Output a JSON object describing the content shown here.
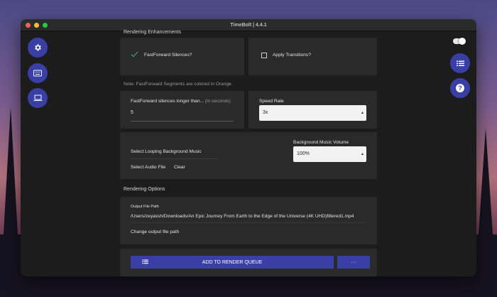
{
  "window": {
    "title": "TimeBolt | 4.4.1"
  },
  "sidebar_left": {
    "buttons": [
      {
        "icon": "gear-icon"
      },
      {
        "icon": "keyboard-icon"
      },
      {
        "icon": "laptop-icon"
      }
    ]
  },
  "sidebar_right": {
    "buttons": [
      {
        "icon": "list-icon"
      },
      {
        "icon": "help-icon"
      }
    ]
  },
  "rendering_enhancements": {
    "title": "Rendering Enhancements",
    "fastforward_silences": {
      "label": "FastForward Silences?",
      "checked": true
    },
    "apply_transitions": {
      "label": "Apply Transitions?",
      "checked": false
    },
    "note": "Note: FastForward Segments are colored in Orange.",
    "silence_threshold": {
      "label": "FastForward silences longer than...",
      "hint": "(in seconds)",
      "value": "5"
    },
    "speed_rate": {
      "label": "Speed Rate",
      "value": "3x"
    },
    "music": {
      "select_label": "Select Looping Background Music",
      "select_audio": "Select Audio File",
      "clear": "Clear",
      "volume_label": "Background Music Volume",
      "volume_value": "100%"
    }
  },
  "rendering_options": {
    "title": "Rendering Options",
    "output_label": "Output File Path",
    "output_path": "/Users/zeyassh/Downloads/An Epic Journey From Earth to the Edge of the Universe (4K UHD)filtered1.mp4",
    "change_path": "Change output file path"
  },
  "actions": {
    "add_to_queue": "ADD TO RENDER QUEUE",
    "more": "···"
  },
  "colors": {
    "accent": "#3a3fa6",
    "check": "#3fae7a"
  }
}
